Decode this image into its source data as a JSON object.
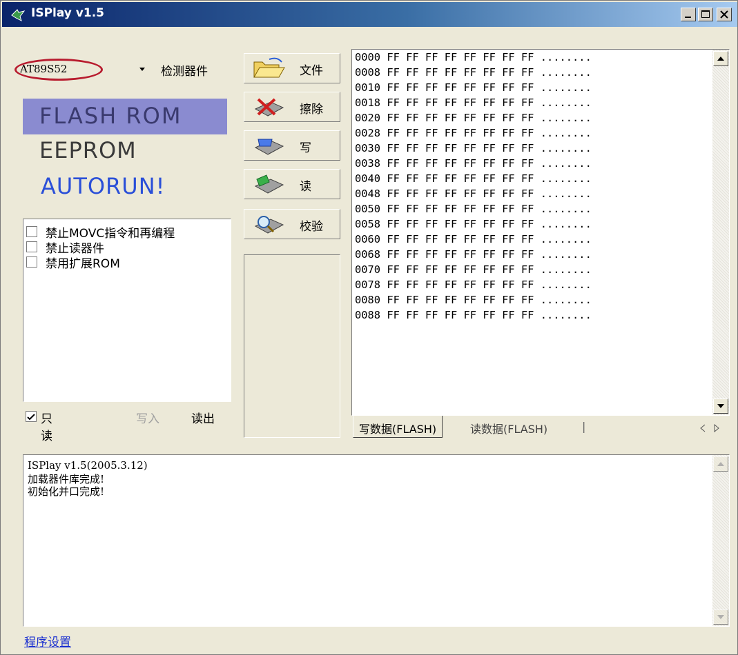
{
  "window": {
    "title": "ISPlay v1.5"
  },
  "chip": {
    "selected": "AT89S52",
    "detect_label": "检测器件"
  },
  "modes": {
    "flash": "FLASH ROM",
    "eeprom": "EEPROM",
    "autorun": "AUTORUN!"
  },
  "options": [
    {
      "label": "禁止MOVC指令和再编程",
      "checked": false
    },
    {
      "label": "禁止读器件",
      "checked": false
    },
    {
      "label": "禁用扩展ROM",
      "checked": false
    }
  ],
  "readonly": {
    "label": "只读",
    "checked": true
  },
  "write_in_label": "写入",
  "read_out_label": "读出",
  "actions": {
    "file": "文件",
    "erase": "擦除",
    "write": "写",
    "read": "读",
    "verify": "校验"
  },
  "hex_rows": [
    "0000 FF FF FF FF FF FF FF FF ........",
    "0008 FF FF FF FF FF FF FF FF ........",
    "0010 FF FF FF FF FF FF FF FF ........",
    "0018 FF FF FF FF FF FF FF FF ........",
    "0020 FF FF FF FF FF FF FF FF ........",
    "0028 FF FF FF FF FF FF FF FF ........",
    "0030 FF FF FF FF FF FF FF FF ........",
    "0038 FF FF FF FF FF FF FF FF ........",
    "0040 FF FF FF FF FF FF FF FF ........",
    "0048 FF FF FF FF FF FF FF FF ........",
    "0050 FF FF FF FF FF FF FF FF ........",
    "0058 FF FF FF FF FF FF FF FF ........",
    "0060 FF FF FF FF FF FF FF FF ........",
    "0068 FF FF FF FF FF FF FF FF ........",
    "0070 FF FF FF FF FF FF FF FF ........",
    "0078 FF FF FF FF FF FF FF FF ........",
    "0080 FF FF FF FF FF FF FF FF ........",
    "0088 FF FF FF FF FF FF FF FF ........"
  ],
  "tabs": {
    "active": "写数据(FLASH)",
    "inactive": "读数据(FLASH)",
    "separator": "|"
  },
  "log_lines": [
    "ISPlay v1.5(2005.3.12)",
    "加载器件库完成!",
    "初始化并口完成!"
  ],
  "settings_link": "程序设置",
  "colors": {
    "window_bg": "#ece9d8",
    "flash_highlight": "#8a8bd0",
    "autorun_blue": "#2a4fd8",
    "chip_ring_red": "#b81c2f",
    "link_blue": "#1a2fd0"
  }
}
